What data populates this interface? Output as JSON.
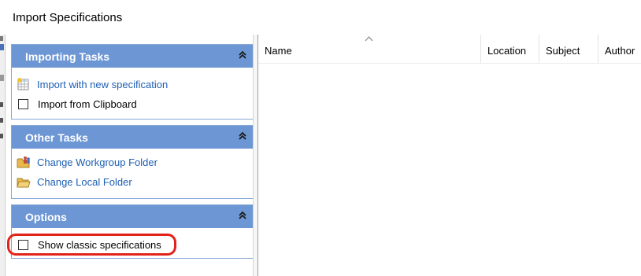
{
  "window": {
    "title": "Import Specifications"
  },
  "panels": {
    "importing": {
      "title": "Importing Tasks",
      "items": [
        {
          "label": "Import with new specification",
          "icon": "spreadsheet-new-icon"
        },
        {
          "label": "Import from Clipboard",
          "icon": "checkbox"
        }
      ]
    },
    "other": {
      "title": "Other Tasks",
      "items": [
        {
          "label": "Change Workgroup Folder",
          "icon": "workgroup-folder-icon"
        },
        {
          "label": "Change Local Folder",
          "icon": "local-folder-icon"
        }
      ]
    },
    "options": {
      "title": "Options",
      "items": [
        {
          "label": "Show classic specifications",
          "checked": false
        }
      ]
    }
  },
  "list": {
    "columns": [
      "Name",
      "Location",
      "Subject",
      "Author"
    ],
    "sorted_column": "Name",
    "sort_direction": "ascending",
    "rows": []
  },
  "colors": {
    "panel_header": "#6c96d4",
    "link": "#1e5fb3",
    "highlight": "#e2231a"
  }
}
